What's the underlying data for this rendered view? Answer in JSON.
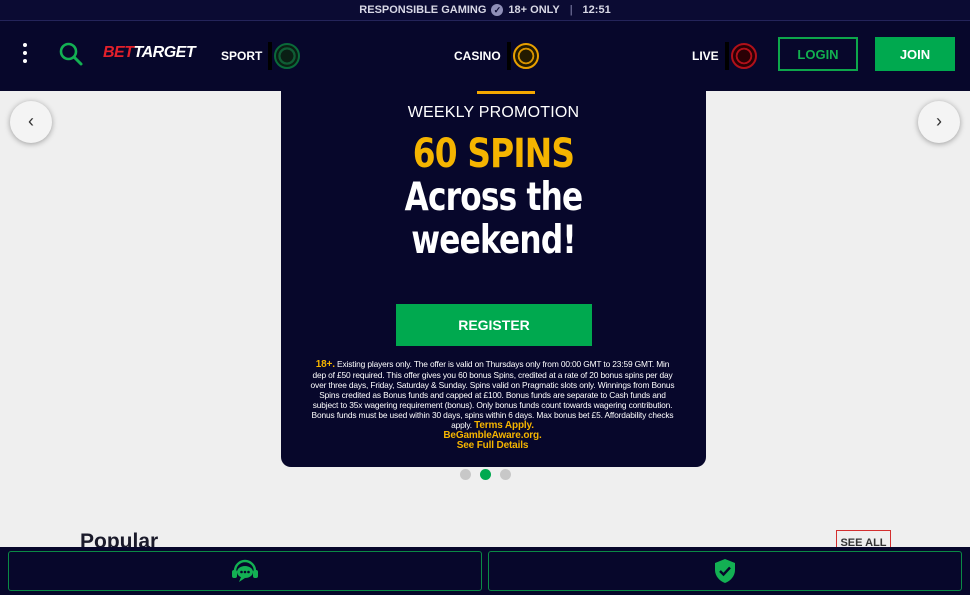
{
  "topbar": {
    "responsible_gaming": "RESPONSIBLE GAMING",
    "age": "18+ ONLY",
    "separator": "|",
    "time": "12:51"
  },
  "header": {
    "logo_part1": "BET",
    "logo_part2": "TARGET",
    "nav": [
      {
        "label": "SPORT",
        "icon": "sport-chip-icon",
        "color": "#0a6a3a"
      },
      {
        "label": "CASINO",
        "icon": "casino-chip-icon",
        "color": "#e8a000"
      },
      {
        "label": "LIVE",
        "icon": "live-chip-icon",
        "color": "#b0101a"
      }
    ],
    "login_label": "LOGIN",
    "join_label": "JOIN"
  },
  "promo": {
    "eyebrow": "WEEKLY PROMOTION",
    "highlight": "60 SPINS",
    "headline_line1": "Across the",
    "headline_line2": "weekend!",
    "register_label": "REGISTER",
    "terms_age": "18+.",
    "terms_text": " Existing players only. The offer is valid on Thursdays only from 00:00 GMT to 23:59 GMT. Min dep of £50 required. This offer gives you 60 bonus Spins, credited at a rate of 20 bonus spins per day over three days, Friday, Saturday & Sunday. Spins valid on Pragmatic slots only. Winnings from Bonus Spins credited as Bonus funds and capped at £100. Bonus funds are separate to Cash funds and subject to 35x wagering requirement (bonus). Only bonus funds count towards wagering contribution. Bonus funds must be used within 30 days, spins within 6 days. Max bonus bet £5. Affordability checks apply. ",
    "terms_link": "Terms Apply.",
    "gamble_aware": "BeGambleAware.org.",
    "see_full": "See Full Details"
  },
  "carousel": {
    "prev_icon": "chevron-left-icon",
    "next_icon": "chevron-right-icon",
    "slide_count": 3,
    "active_slide": 2
  },
  "popular": {
    "title": "Popular",
    "see_all": "SEE ALL"
  },
  "bottom_bar": {
    "chat_icon": "chat-support-icon",
    "shield_icon": "shield-check-icon"
  },
  "colors": {
    "navy": "#07072b",
    "green": "#00a94f",
    "yellow": "#f5b400",
    "red": "#e3202b"
  }
}
